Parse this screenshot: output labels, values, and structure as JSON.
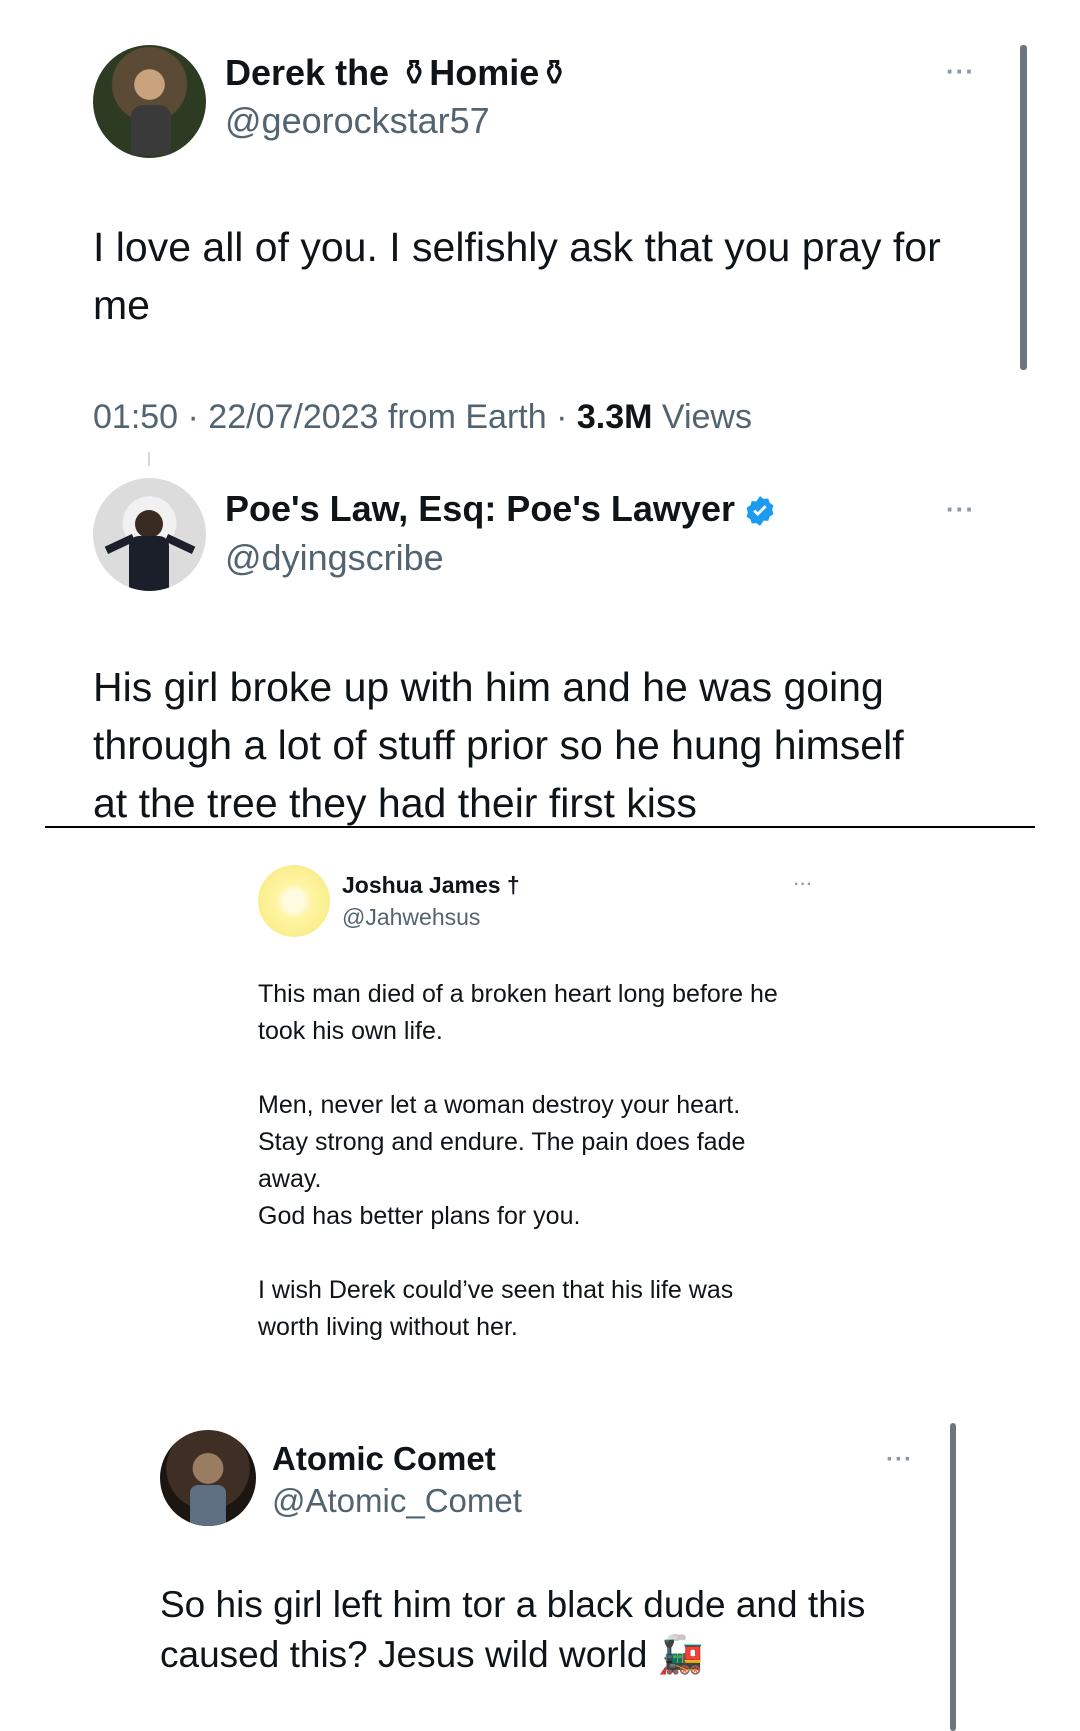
{
  "tweet1": {
    "name": "Derek the ⚱Homie⚱",
    "handle": "@georockstar57",
    "text_line1": "I love all of you. I selfishly ask that you pray for",
    "text_line2": "me",
    "time": "01:50 · 22/07/2023 from Earth · ",
    "views_count": "3.3M",
    "views_label": " Views",
    "more_icon": "more-horizontal-icon"
  },
  "tweet2": {
    "name": "Poe's Law, Esq: Poe's Lawyer",
    "verified": true,
    "handle": "@dyingscribe",
    "text_line1": "His girl broke up with him and he was going",
    "text_line2": "through a lot of stuff prior so he hung himself",
    "text_line3": "at the tree they had their first kiss",
    "more_icon": "more-horizontal-icon"
  },
  "tweet3": {
    "name": "Joshua James †",
    "handle": "@Jahwehsus",
    "p1_line1": "This man died of a broken heart long before he",
    "p1_line2": "took his own life.",
    "p2_line1": "Men, never let a woman destroy your heart.",
    "p2_line2": "Stay strong and endure. The pain does fade",
    "p2_line3": "away.",
    "p2_line4": "God has better plans for you.",
    "p3_line1": "I wish Derek could’ve seen that his life was",
    "p3_line2": "worth living without her."
  },
  "tweet4": {
    "name": "Atomic Comet",
    "handle": "@Atomic_Comet",
    "text_line1": "So his girl left him tor a black dude and this",
    "text_line2": "caused this? Jesus wild world 🚂"
  },
  "colors": {
    "text": "#0f1419",
    "secondary": "#536471",
    "verified": "#1d9bf0",
    "divider": "#000000",
    "scrollbar": "#6e767d"
  }
}
